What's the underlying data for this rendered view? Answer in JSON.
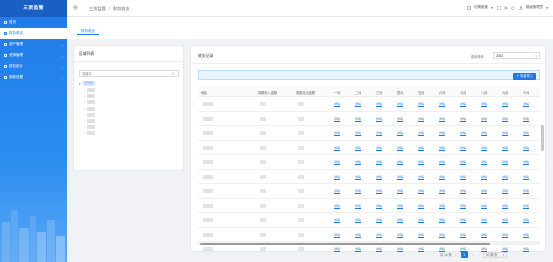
{
  "app": {
    "title": "三资监管"
  },
  "sidebar": {
    "items": [
      {
        "label": "首页",
        "active": false
      },
      {
        "label": "财务收支",
        "active": true
      },
      {
        "label": "资产管理",
        "active": false
      },
      {
        "label": "资源管理",
        "active": false
      },
      {
        "label": "报告统计",
        "active": false
      },
      {
        "label": "参数设置",
        "active": false
      }
    ]
  },
  "topbar": {
    "breadcrumb": [
      "三资监管",
      "财务收支"
    ],
    "switch_label": "切换账套",
    "user_label": "超级管理员"
  },
  "tabs": [
    {
      "label": "财务收支"
    }
  ],
  "left_panel": {
    "title": "区域列表",
    "search_placeholder": "关键字"
  },
  "right_panel": {
    "title": "收支记录",
    "year_label": "查询年份",
    "year_value": "2024",
    "add_button": "批量导入"
  },
  "table": {
    "headers": [
      "地区",
      "常数收入金额",
      "常数支出金额",
      "一月",
      "二月",
      "三月",
      "四月",
      "五月",
      "六月",
      "七月",
      "八月",
      "九月",
      "十月"
    ],
    "link_text": "详情",
    "row_count": 12
  },
  "pager": {
    "total": "共 10 条",
    "page": "1",
    "page_size": "10 条/页"
  },
  "colors": {
    "primary": "#1f7ae8",
    "sidebar_dark": "#1a5fc4"
  }
}
